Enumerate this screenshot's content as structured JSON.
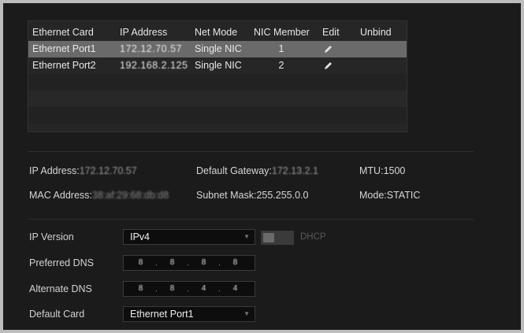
{
  "nic_table": {
    "headers": [
      "Ethernet Card",
      "IP Address",
      "Net Mode",
      "NIC Member",
      "Edit",
      "Unbind"
    ],
    "rows": [
      {
        "card": "Ethernet Port1",
        "ip": "172.12.70.57",
        "mode": "Single NIC",
        "member": "1"
      },
      {
        "card": "Ethernet Port2",
        "ip": "192.168.2.125",
        "mode": "Single NIC",
        "member": "2"
      }
    ]
  },
  "info": {
    "ip_label": "IP Address:",
    "ip_value": "172.12.70.57",
    "gateway_label": "Default Gateway:",
    "gateway_value": "172.13.2.1",
    "mtu_label": "MTU:",
    "mtu_value": "1500",
    "mac_label": "MAC Address:",
    "mac_value": "38:af:29:68:db:d8",
    "subnet_label": "Subnet Mask:",
    "subnet_value": "255.255.0.0",
    "mode_label": "Mode:",
    "mode_value": "STATIC"
  },
  "form": {
    "ip_version_label": "IP Version",
    "ip_version_value": "IPv4",
    "dhcp_label": "DHCP",
    "preferred_dns_label": "Preferred DNS",
    "preferred_dns_segments": [
      "8",
      "8",
      "8",
      "8"
    ],
    "alternate_dns_label": "Alternate DNS",
    "alternate_dns_segments": [
      "8",
      "8",
      "4",
      "4"
    ],
    "default_card_label": "Default Card",
    "default_card_value": "Ethernet Port1"
  },
  "colors": {
    "background": "#1b1b1b",
    "selected_row": "#6a6a6a",
    "input_bg": "#0d0d0d"
  }
}
